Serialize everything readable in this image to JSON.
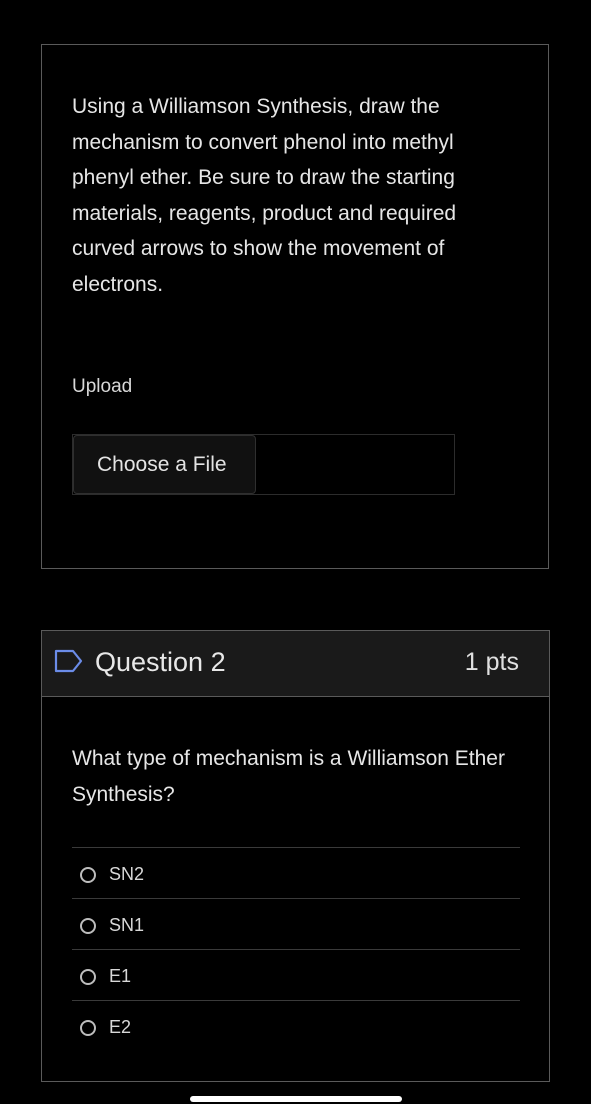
{
  "question1": {
    "text": "Using a Williamson Synthesis, draw the mechanism to convert phenol into methyl phenyl ether. Be sure to draw the starting materials, reagents, product and required curved arrows to show the movement of electrons.",
    "upload_label": "Upload",
    "choose_file_label": "Choose a File"
  },
  "question2": {
    "title": "Question 2",
    "points": "1 pts",
    "flag_icon": "flag-outline-icon",
    "text": "What type of mechanism is a Williamson Ether Synthesis?",
    "answers": [
      {
        "label": "SN2"
      },
      {
        "label": "SN1"
      },
      {
        "label": "E1"
      },
      {
        "label": "E2"
      }
    ]
  },
  "colors": {
    "background": "#000000",
    "border": "#5a5a5a",
    "header_bg": "#1a1a1a",
    "text": "#e6e6e6",
    "flag": "#6b8ce8"
  }
}
